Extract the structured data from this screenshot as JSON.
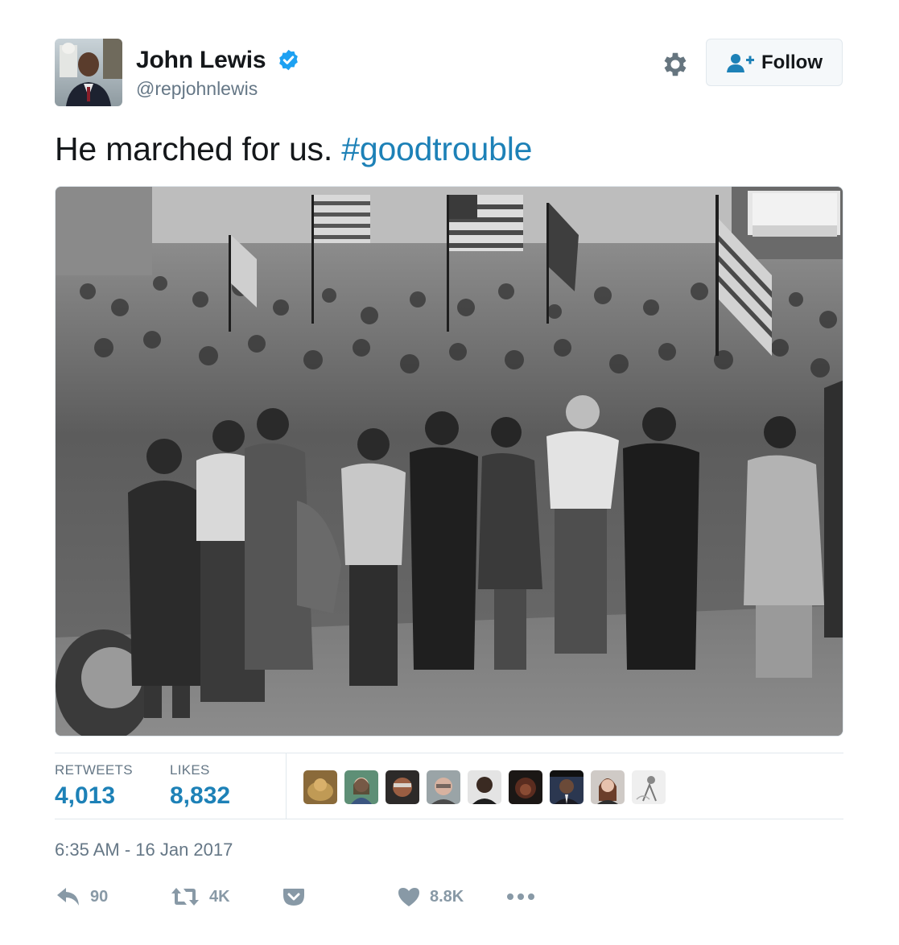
{
  "user": {
    "name": "John Lewis",
    "handle": "@repjohnlewis",
    "verified": true
  },
  "follow_button": {
    "label": "Follow"
  },
  "tweet": {
    "text": "He marched for us. ",
    "hashtag": "#goodtrouble"
  },
  "stats": {
    "retweets_label": "RETWEETS",
    "retweets_value": "4,013",
    "likes_label": "LIKES",
    "likes_value": "8,832"
  },
  "timestamp": "6:35 AM - 16 Jan 2017",
  "actions": {
    "reply_count": "90",
    "retweet_count": "4K",
    "like_count": "8.8K"
  },
  "colors": {
    "link": "#1d81b7",
    "verified": "#1da1f2",
    "muted": "#657786",
    "icon": "#8899a6"
  },
  "icons": {
    "settings": "gear-icon",
    "follow": "follow-person-icon",
    "verified": "verified-badge-icon",
    "reply": "reply-icon",
    "retweet": "retweet-icon",
    "pocket": "pocket-icon",
    "like": "heart-icon",
    "more": "more-dots-icon"
  }
}
